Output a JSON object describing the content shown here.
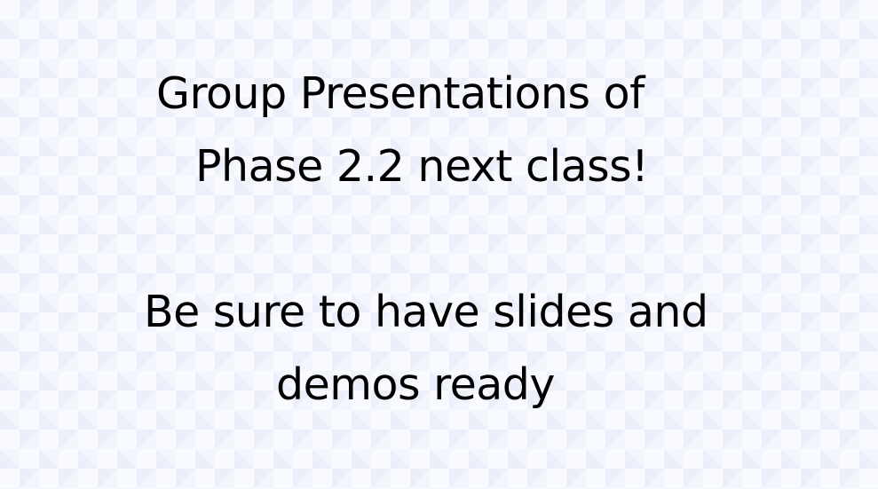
{
  "slide": {
    "announcement": {
      "line1": "Group Presentations of",
      "line2": "Phase 2.2 next class!"
    },
    "reminder": {
      "line1": "Be sure to have slides and",
      "line2": "demos ready"
    }
  },
  "theme": {
    "background": "#f9faff",
    "text_color": "#000000"
  }
}
